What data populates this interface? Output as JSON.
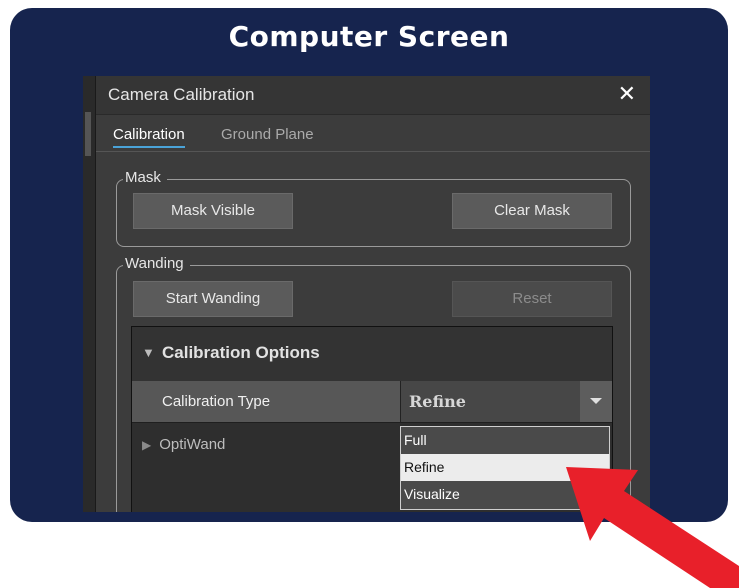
{
  "frame": {
    "title": "Computer Screen"
  },
  "window": {
    "title": "Camera Calibration",
    "close_glyph": "✕"
  },
  "tabs": [
    {
      "label": "Calibration",
      "active": true
    },
    {
      "label": "Ground Plane",
      "active": false
    }
  ],
  "mask_group": {
    "legend": "Mask",
    "mask_visible_label": "Mask Visible",
    "clear_mask_label": "Clear Mask"
  },
  "wanding_group": {
    "legend": "Wanding",
    "start_wanding_label": "Start Wanding",
    "reset_label": "Reset"
  },
  "calibration_options": {
    "header": "Calibration Options",
    "calibration_type_label": "Calibration Type",
    "calibration_type_value": "Refine",
    "optiwand_label": "OptiWand",
    "dropdown_options": [
      "Full",
      "Refine",
      "Visualize"
    ],
    "selected_option": "Refine"
  },
  "colors": {
    "frame_bg": "#16244e",
    "panel_bg": "#3c3c3c",
    "accent_tab": "#4aa3d8",
    "arrow_red": "#e8202a"
  }
}
